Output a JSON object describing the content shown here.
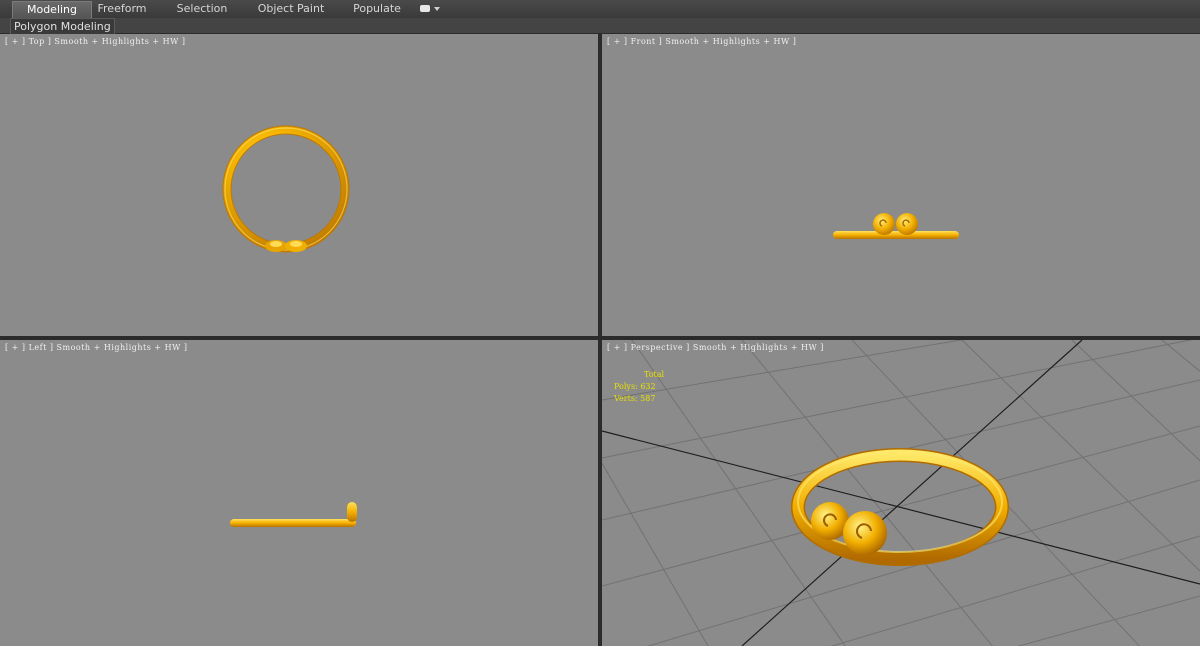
{
  "toolbar": {
    "tabs": [
      {
        "label": "Modeling",
        "active": true
      },
      {
        "label": "Freeform",
        "active": false
      },
      {
        "label": "Selection",
        "active": false
      },
      {
        "label": "Object Paint",
        "active": false
      },
      {
        "label": "Populate",
        "active": false
      }
    ],
    "dropdown_icon": "panel-options-icon"
  },
  "subbar": {
    "panel_label": "Polygon Modeling"
  },
  "viewports": {
    "top": {
      "label": "[ + ] Top ] Smooth + Highlights + HW ]"
    },
    "front": {
      "label": "[ + ] Front ] Smooth + Highlights + HW ]"
    },
    "left": {
      "label": "[ + ] Left ] Smooth + Highlights + HW ]"
    },
    "perspective": {
      "label": "[ + ] Perspective ] Smooth + Highlights + HW ]",
      "stats": {
        "header": "Total",
        "polys_label": "Polys:",
        "polys_value": "632",
        "verts_label": "Verts:",
        "verts_value": "587"
      }
    }
  },
  "colors": {
    "viewport_bg": "#8b8b8b",
    "gold_light": "#ffd94a",
    "gold_mid": "#f5b400",
    "gold_dark": "#c98200",
    "stats_text": "#e8e000",
    "grid_line": "#6e6e6e",
    "grid_axis": "#1e1e1e"
  }
}
